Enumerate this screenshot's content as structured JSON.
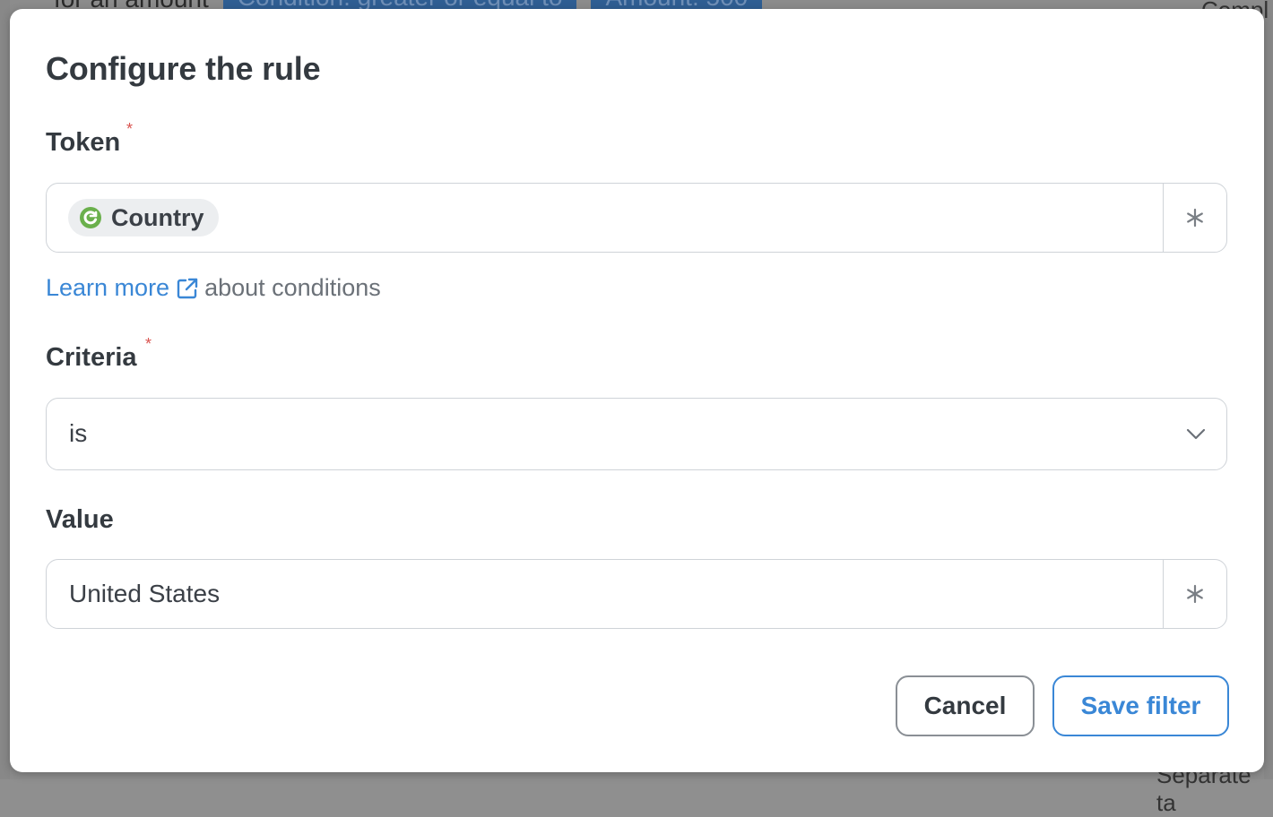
{
  "background": {
    "top_text": "for an amount",
    "chips": [
      "Condition: greater or equal to",
      "Amount: 500"
    ],
    "right_fragment": "Compl",
    "bottom_right_fragment": "Separate ta"
  },
  "modal": {
    "title": "Configure the rule",
    "token": {
      "label": "Token",
      "required_mark": "*",
      "chip_label": "Country",
      "chip_icon": "refresh-circle-icon",
      "chip_icon_color": "#6ab04c",
      "addon_icon": "asterisk-icon"
    },
    "help": {
      "link_text": "Learn more",
      "link_icon": "external-link-icon",
      "suffix": "about conditions"
    },
    "criteria": {
      "label": "Criteria",
      "required_mark": "*",
      "selected": "is",
      "icon": "chevron-down-icon"
    },
    "value": {
      "label": "Value",
      "text": "United States",
      "addon_icon": "asterisk-icon"
    },
    "actions": {
      "cancel_label": "Cancel",
      "save_label": "Save filter"
    }
  },
  "colors": {
    "accent": "#3a87d6",
    "required": "#d9534f",
    "overlay": "#8c8c8c"
  }
}
